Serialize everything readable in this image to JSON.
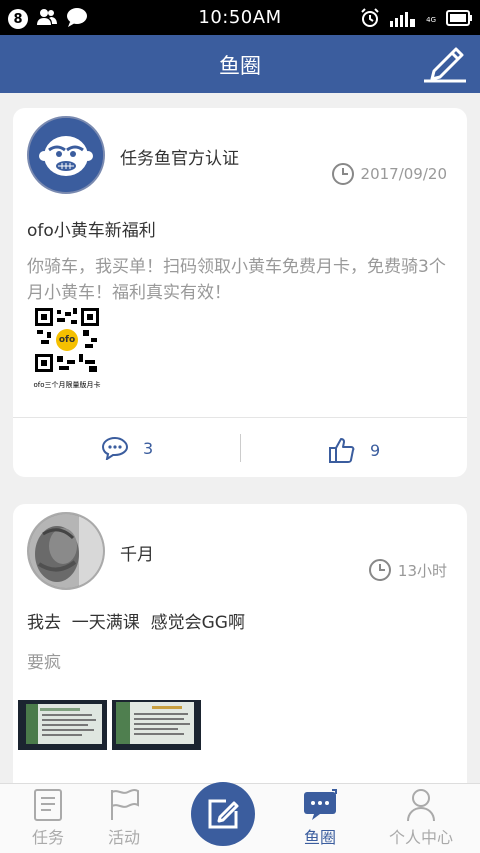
{
  "status_bar": {
    "notification_count": "8",
    "time": "10:50AM",
    "network_label": "4G",
    "icons": [
      "notification-badge",
      "contacts-icon",
      "message-icon",
      "alarm-icon",
      "signal-icon",
      "battery-icon"
    ]
  },
  "header": {
    "title": "鱼圈",
    "edit_icon": "pencil-icon"
  },
  "posts": [
    {
      "author": "任务鱼官方认证",
      "time": "2017/09/20",
      "title": "ofo小黄车新福利",
      "body": "你骑车，我买单！扫码领取小黄车免费月卡，免费骑3个月小黄车！福利真实有效！",
      "qr_logo": "ofo",
      "qr_caption": "ofo三个月限量版月卡",
      "comments": "3",
      "likes": "9"
    },
    {
      "author": "千月",
      "time": "13小时",
      "title": "我去  一天满课  感觉会GG啊",
      "body": "要疯"
    }
  ],
  "tabs": [
    {
      "label": "任务",
      "icon": "task-icon"
    },
    {
      "label": "活动",
      "icon": "flag-icon"
    },
    {
      "label": "",
      "icon": "compose-icon"
    },
    {
      "label": "鱼圈",
      "icon": "chat-icon"
    },
    {
      "label": "个人中心",
      "icon": "user-icon"
    }
  ],
  "colors": {
    "brand": "#3b5d9e",
    "status_bar": "#000000",
    "inactive": "#aaaaaa"
  }
}
